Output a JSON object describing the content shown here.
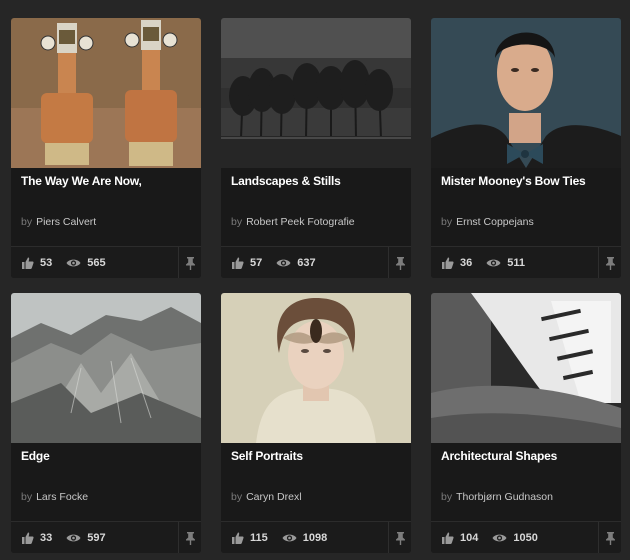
{
  "colors": {
    "page_background": "#262626",
    "card_background": "#191919",
    "title_text": "#ffffff",
    "muted_text": "#7a7a7a",
    "author_text": "#c8c8c8",
    "icon_color": "#9a9a9a"
  },
  "cards": [
    {
      "title": "The Way We Are Now,",
      "by": "by",
      "author": "Piers Calvert",
      "likes": "53",
      "views": "565",
      "like_icon": "thumbs-up-icon",
      "view_icon": "eye-icon",
      "pin_icon": "pin-icon"
    },
    {
      "title": "Landscapes & Stills",
      "by": "by",
      "author": "Robert Peek Fotografie",
      "likes": "57",
      "views": "637",
      "like_icon": "thumbs-up-icon",
      "view_icon": "eye-icon",
      "pin_icon": "pin-icon"
    },
    {
      "title": "Mister Mooney's Bow Ties",
      "by": "by",
      "author": "Ernst Coppejans",
      "likes": "36",
      "views": "511",
      "like_icon": "thumbs-up-icon",
      "view_icon": "eye-icon",
      "pin_icon": "pin-icon"
    },
    {
      "title": "Edge",
      "by": "by",
      "author": "Lars Focke",
      "likes": "33",
      "views": "597",
      "like_icon": "thumbs-up-icon",
      "view_icon": "eye-icon",
      "pin_icon": "pin-icon"
    },
    {
      "title": "Self Portraits",
      "by": "by",
      "author": "Caryn Drexl",
      "likes": "115",
      "views": "1098",
      "like_icon": "thumbs-up-icon",
      "view_icon": "eye-icon",
      "pin_icon": "pin-icon"
    },
    {
      "title": "Architectural Shapes",
      "by": "by",
      "author": "Thorbjørn Gudnason",
      "likes": "104",
      "views": "1050",
      "like_icon": "thumbs-up-icon",
      "view_icon": "eye-icon",
      "pin_icon": "pin-icon"
    }
  ]
}
